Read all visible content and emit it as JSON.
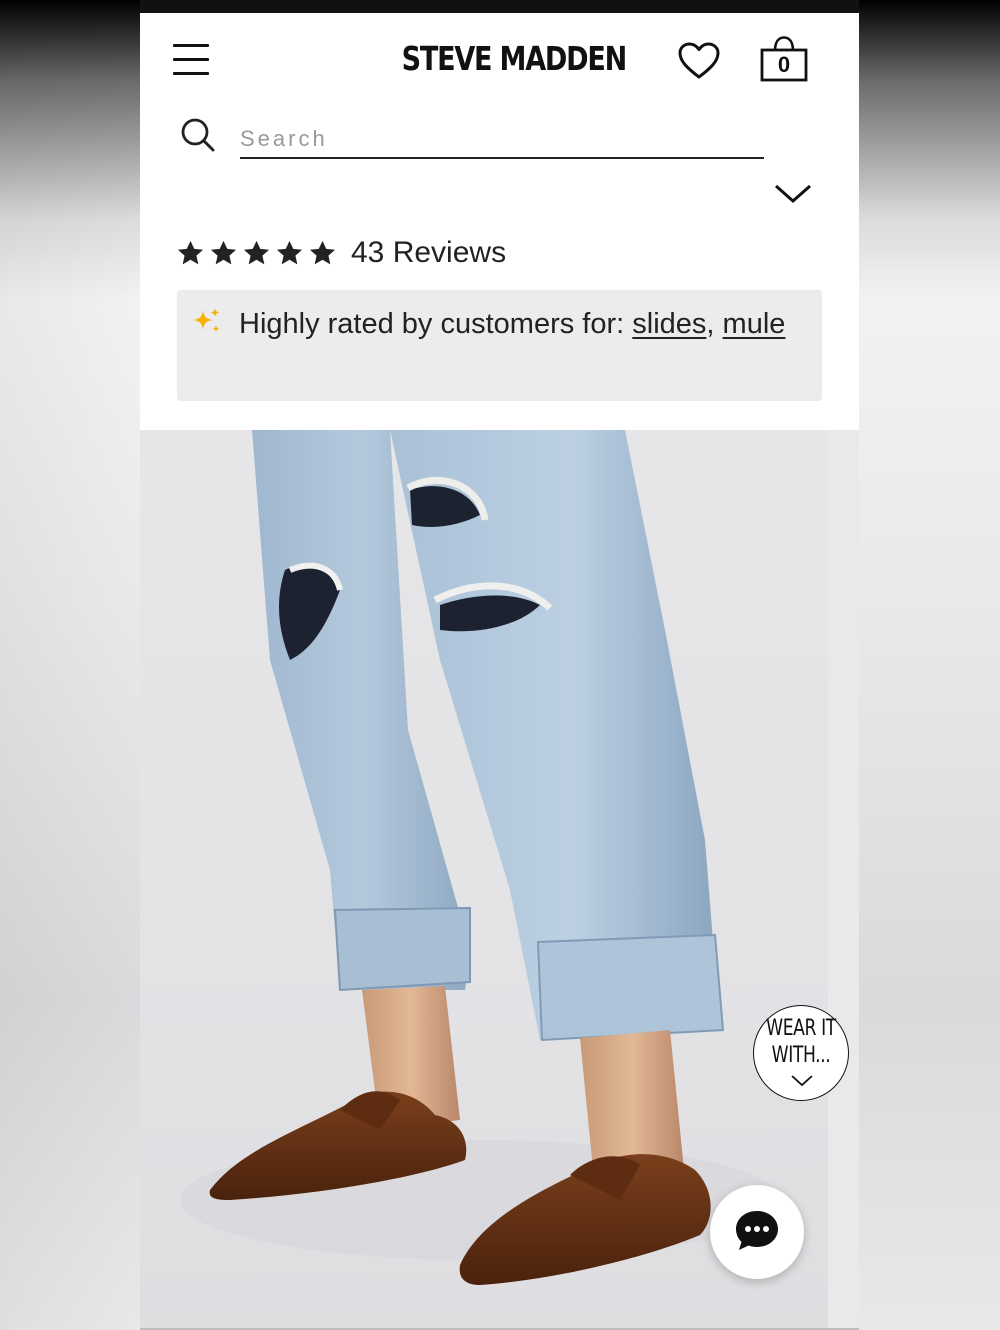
{
  "header": {
    "brand": "STEVE MADDEN",
    "menu_icon": "hamburger-menu-icon",
    "wishlist_icon": "heart-icon",
    "cart_icon": "shopping-bag-icon",
    "cart_count": "0"
  },
  "search": {
    "placeholder": "Search",
    "value": "",
    "icon": "search-icon"
  },
  "collapse_icon": "chevron-down-icon",
  "rating": {
    "stars": 5,
    "reviews_label": "43 Reviews"
  },
  "highlights": {
    "icon": "sparkle-icon",
    "prefix": "Highly rated by customers for:",
    "tags": [
      "slides",
      "mule"
    ]
  },
  "product_image": {
    "alt_content": "model wearing distressed light-wash jeans and brown suede loafer mules"
  },
  "wear_it_with": {
    "line1": "WEAR IT",
    "line2": "WITH..."
  },
  "chat": {
    "icon": "chat-bubble-icon"
  },
  "colors": {
    "text": "#222222",
    "highlight_bg": "#ececec",
    "sparkle": "#f5b000"
  }
}
